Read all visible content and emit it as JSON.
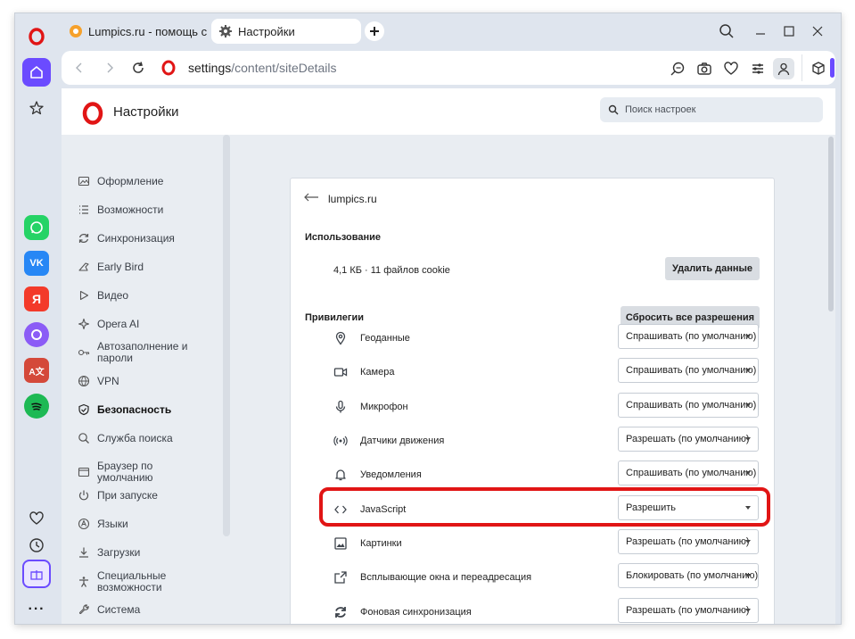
{
  "tabs": [
    {
      "title": "Lumpics.ru - помощь с ко",
      "icon": "orange-favicon-icon",
      "active": false
    },
    {
      "title": "Настройки",
      "icon": "gear-icon",
      "active": true
    }
  ],
  "address": {
    "host": "settings",
    "path": "/content/siteDetails"
  },
  "settings": {
    "title": "Настройки",
    "search_placeholder": "Поиск настроек"
  },
  "nav": [
    {
      "label": "Оформление",
      "icon": "appearance-icon"
    },
    {
      "label": "Возможности",
      "icon": "features-icon"
    },
    {
      "label": "Синхронизация",
      "icon": "sync-icon"
    },
    {
      "label": "Early Bird",
      "icon": "bird-icon"
    },
    {
      "label": "Видео",
      "icon": "play-icon"
    },
    {
      "label": "Opera AI",
      "icon": "ai-icon"
    },
    {
      "label": "Автозаполнение и пароли",
      "icon": "key-icon"
    },
    {
      "label": "VPN",
      "icon": "vpn-icon"
    },
    {
      "label": "Безопасность",
      "icon": "shield-icon",
      "active": true
    },
    {
      "label": "Служба поиска",
      "icon": "search-icon"
    },
    {
      "label": "Браузер по умолчанию",
      "icon": "browser-icon"
    },
    {
      "label": "При запуске",
      "icon": "power-icon"
    },
    {
      "label": "Языки",
      "icon": "language-icon"
    },
    {
      "label": "Загрузки",
      "icon": "download-icon"
    },
    {
      "label": "Специальные возможности",
      "icon": "accessibility-icon"
    },
    {
      "label": "Система",
      "icon": "wrench-icon"
    }
  ],
  "site": {
    "name": "lumpics.ru",
    "usage_heading": "Использование",
    "usage_text": "4,1 КБ · 11 файлов cookie",
    "delete_button": "Удалить данные",
    "privileges_heading": "Привилегии",
    "reset_button": "Сбросить все разрешения",
    "permissions": [
      {
        "label": "Геоданные",
        "value": "Спрашивать (по умолчанию)",
        "icon": "location-icon"
      },
      {
        "label": "Камера",
        "value": "Спрашивать (по умолчанию)",
        "icon": "camera-icon"
      },
      {
        "label": "Микрофон",
        "value": "Спрашивать (по умолчанию)",
        "icon": "microphone-icon"
      },
      {
        "label": "Датчики движения",
        "value": "Разрешать (по умолчанию)",
        "icon": "motion-sensor-icon"
      },
      {
        "label": "Уведомления",
        "value": "Спрашивать (по умолчанию)",
        "icon": "bell-icon"
      },
      {
        "label": "JavaScript",
        "value": "Разрешить",
        "icon": "code-icon"
      },
      {
        "label": "Картинки",
        "value": "Разрешать (по умолчанию)",
        "icon": "image-icon"
      },
      {
        "label": "Всплывающие окна и переадресация",
        "value": "Блокировать (по умолчанию)",
        "icon": "popup-icon"
      },
      {
        "label": "Фоновая синхронизация",
        "value": "Разрешать (по умолчанию)",
        "icon": "sync-icon"
      }
    ]
  },
  "colors": {
    "highlight": "#e11515",
    "opera_red": "#e11515",
    "accent": "#6b4bff"
  }
}
